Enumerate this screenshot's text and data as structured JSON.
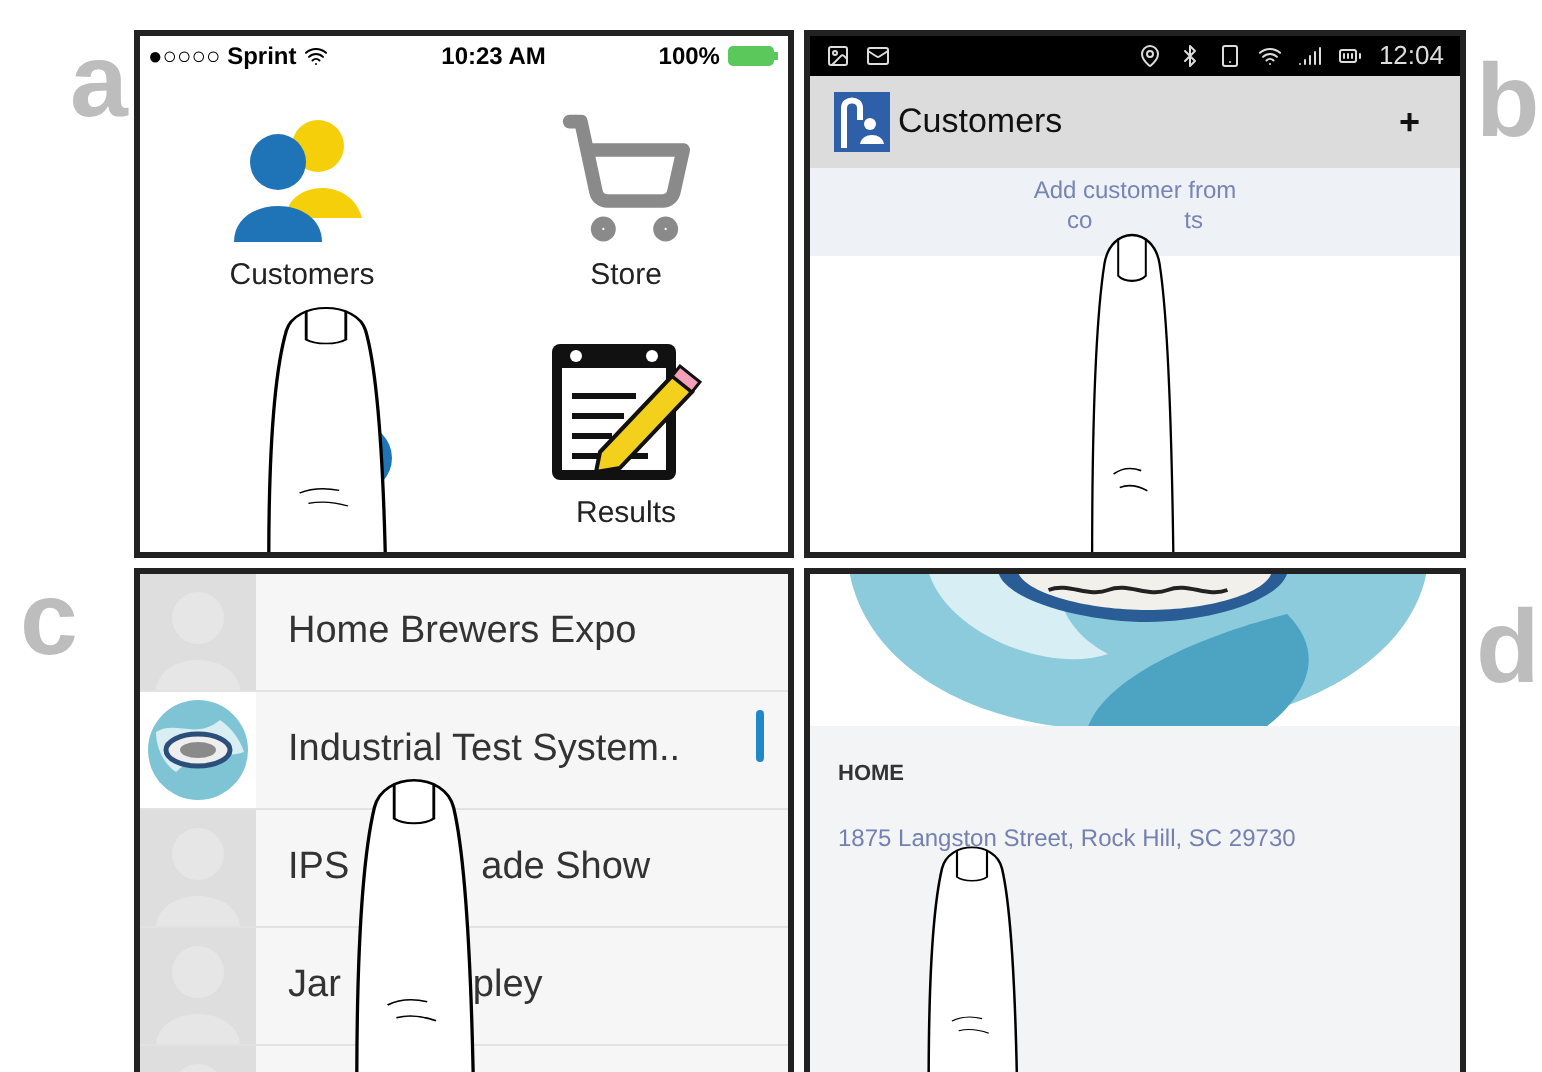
{
  "panels": [
    {
      "label": "a",
      "kind": "home",
      "status_bar": {
        "carrier": "●○○○○ Sprint",
        "time": "10:23 AM",
        "battery": "100%"
      },
      "tiles": [
        {
          "kind": "customers",
          "label": "Customers"
        },
        {
          "kind": "store",
          "label": "Store"
        },
        {
          "kind": "results",
          "label": "Results"
        }
      ]
    },
    {
      "label": "b",
      "kind": "customers",
      "status_bar": {
        "time": "12:04"
      },
      "app_bar": {
        "title": "Customers",
        "add_button": "+"
      },
      "add_from_contacts": {
        "line_1": "Add customer from",
        "line_2_parts": [
          "co",
          "ts"
        ]
      }
    },
    {
      "label": "c",
      "kind": "list",
      "rows": [
        {
          "kind": "placeholder",
          "parts": [
            "Home Brewers Expo"
          ]
        },
        {
          "kind": "picture",
          "parts": [
            "Industrial Test System.."
          ]
        },
        {
          "kind": "placeholder",
          "parts": [
            "IPS",
            "ade Show"
          ]
        },
        {
          "kind": "placeholder",
          "parts": [
            "Jar",
            "pley"
          ]
        },
        {
          "kind": "placeholder"
        }
      ]
    },
    {
      "label": "d",
      "kind": "detail",
      "section": "HOME",
      "address": "1875 Langston Street, Rock Hill, SC 29730"
    }
  ]
}
